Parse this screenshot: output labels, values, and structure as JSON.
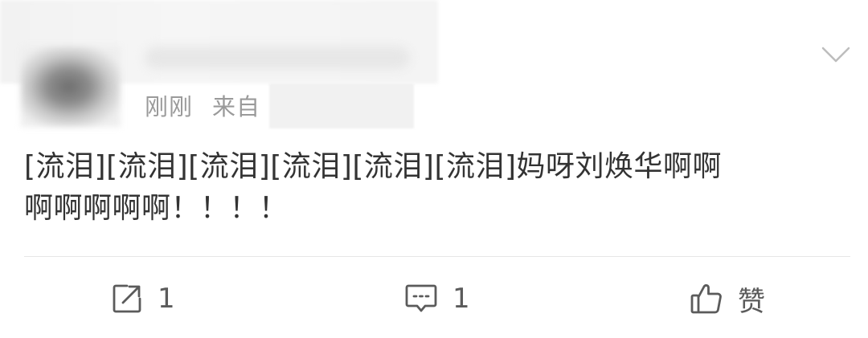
{
  "post": {
    "time": "刚刚",
    "source_prefix": "来自",
    "content_line1": "[流泪][流泪][流泪][流泪][流泪][流泪]妈呀刘焕华啊啊",
    "content_line2": "啊啊啊啊啊！！！！"
  },
  "actions": {
    "repost_count": "1",
    "comment_count": "1",
    "like_label": "赞"
  },
  "colors": {
    "text": "#333333",
    "meta": "#9a9a9a",
    "icon": "#5b5b5b",
    "divider": "#e6e6e6"
  }
}
